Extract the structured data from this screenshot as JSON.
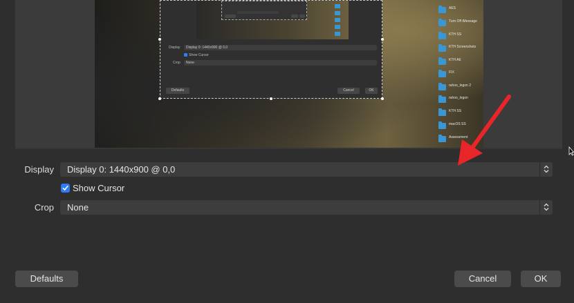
{
  "preview": {
    "nested": {
      "display_label": "Display",
      "display_value": "Display 0: 1440x900 @ 0,0",
      "show_cursor_label": "Show Cursor",
      "crop_label": "Crop",
      "crop_value": "None",
      "defaults_label": "Defaults",
      "cancel_label": "Cancel",
      "ok_label": "OK"
    },
    "desktop_folders": [
      "AES",
      "Turn Off iMessage",
      "KTH SS",
      "KTH Screenshots",
      "KTH AE",
      "FIX",
      "rahoo_logon 2",
      "rahoo_logon",
      "KTH SS",
      "macOS SS",
      "Assessment"
    ]
  },
  "form": {
    "display_label": "Display",
    "display_value": "Display 0: 1440x900 @ 0,0",
    "show_cursor_label": "Show Cursor",
    "show_cursor_checked": true,
    "crop_label": "Crop",
    "crop_value": "None"
  },
  "buttons": {
    "defaults": "Defaults",
    "cancel": "Cancel",
    "ok": "OK"
  },
  "colors": {
    "accent": "#2f7bf6",
    "annotation_arrow": "#e8262a",
    "folder": "#3b97d3"
  }
}
